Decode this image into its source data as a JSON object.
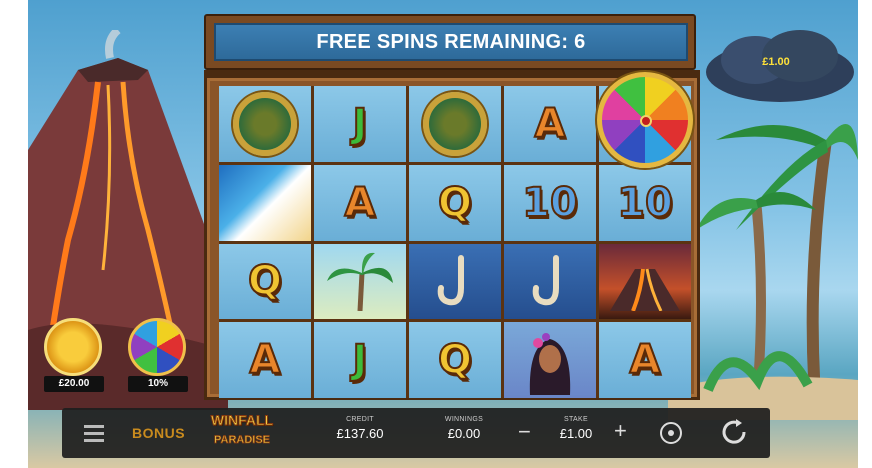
{
  "game": {
    "banner": "FREE SPINS REMAINING: 6",
    "cloud_value": "£1.00",
    "logo_line1": "WINFALL",
    "logo_line2": "PARADISE"
  },
  "side_features": [
    {
      "name": "volcano-bonus-coin",
      "value": "£20.00"
    },
    {
      "name": "wheel-bonus-coin",
      "value": "10%"
    }
  ],
  "reels": [
    [
      "turtle-coin",
      "J",
      "turtle-coin",
      "A",
      "wheel"
    ],
    [
      "wave",
      "A",
      "Q",
      "10",
      "10"
    ],
    [
      "Q",
      "palm-tree",
      "fish-hook",
      "fish-hook",
      "volcano"
    ],
    [
      "A",
      "J",
      "Q",
      "island-woman",
      "A"
    ]
  ],
  "bar": {
    "bonus_label": "BONUS",
    "credit_label": "CREDIT",
    "credit_value": "£137.60",
    "winnings_label": "WINNINGS",
    "winnings_value": "£0.00",
    "stake_label": "STAKE",
    "stake_value": "£1.00",
    "minus": "−",
    "plus": "+"
  },
  "colors": {
    "banner_bg": "#2e6a9a",
    "frame": "#8a5528",
    "bonus_text": "#c98b1e",
    "cloud_text": "#ffe23a"
  }
}
